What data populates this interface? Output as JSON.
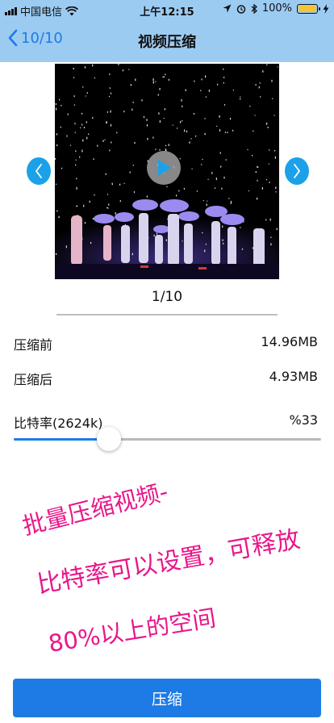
{
  "status_bar": {
    "carrier": "中国电信",
    "time": "上午12:15",
    "battery": "100%"
  },
  "nav": {
    "back_label": "10/10",
    "title": "视频压缩"
  },
  "video": {
    "page_indicator": "1/10"
  },
  "info": {
    "before_label": "压缩前",
    "before_value": "14.96MB",
    "after_label": "压缩后",
    "after_value": "4.93MB",
    "bitrate_label": "比特率(2624k)",
    "bitrate_value": "%33",
    "bitrate_level": 0.31
  },
  "promo": {
    "line1": "批量压缩视频-",
    "line2": "比特率可以设置，可释放",
    "line3": "80%以上的空间"
  },
  "action": {
    "compress_label": "压缩"
  },
  "colors": {
    "nav_bg": "#9CCBF2",
    "accent": "#1E7BE6",
    "arrow_button": "#1CA1E8",
    "promo_text": "#E8178A"
  }
}
